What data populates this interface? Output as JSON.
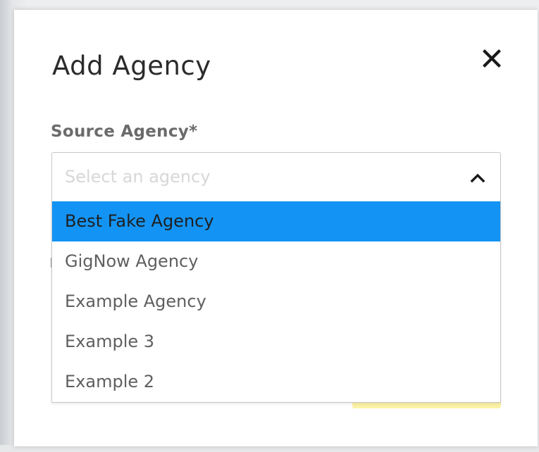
{
  "modal": {
    "title": "Add Agency",
    "close_icon": "close-icon"
  },
  "source_agency": {
    "label": "Source Agency*",
    "placeholder": "Select an agency",
    "chevron_icon": "chevron-up-icon",
    "options": [
      {
        "label": "Best Fake Agency",
        "highlighted": true
      },
      {
        "label": "GigNow Agency",
        "highlighted": false
      },
      {
        "label": "Example Agency",
        "highlighted": false
      },
      {
        "label": "Example 3",
        "highlighted": false
      },
      {
        "label": "Example 2",
        "highlighted": false
      }
    ]
  },
  "colors": {
    "highlight": "#1394f4",
    "submit_button_partial": "#fbf2a6"
  }
}
